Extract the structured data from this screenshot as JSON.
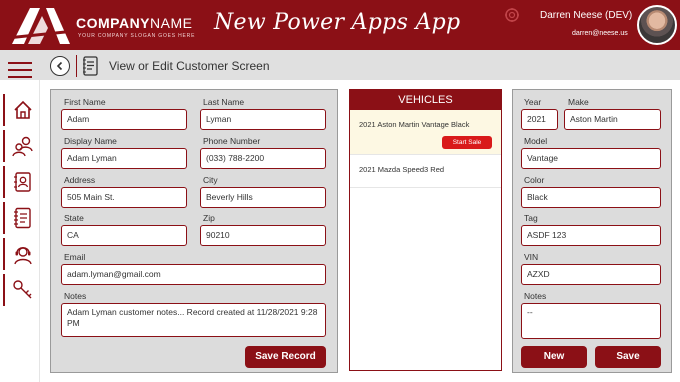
{
  "header": {
    "company_bold": "COMPANY",
    "company_light": "NAME",
    "slogan": "YOUR COMPANY SLOGAN GOES HERE",
    "app_title": "New Power Apps App",
    "user_name": "Darren Neese (DEV)",
    "user_email": "darren@neese.us"
  },
  "subheader": {
    "screen_title": "View or Edit Customer Screen"
  },
  "sidebar": {
    "items": [
      "home-icon",
      "people-icon",
      "contact-card-icon",
      "notebook-icon",
      "support-agent-icon",
      "keys-icon"
    ]
  },
  "customer": {
    "first_name_label": "First Name",
    "first_name": "Adam",
    "last_name_label": "Last Name",
    "last_name": "Lyman",
    "display_name_label": "Display Name",
    "display_name": "Adam Lyman",
    "phone_label": "Phone Number",
    "phone": "(033) 788-2200",
    "address_label": "Address",
    "address": "505 Main St.",
    "city_label": "City",
    "city": "Beverly Hills",
    "state_label": "State",
    "state": "CA",
    "zip_label": "Zip",
    "zip": "90210",
    "email_label": "Email",
    "email": "adam.lyman@gmail.com",
    "notes_label": "Notes",
    "notes": "Adam Lyman customer notes... Record created at 11/28/2021 9:28 PM",
    "save_label": "Save Record"
  },
  "vehicles": {
    "title": "VEHICLES",
    "items": [
      {
        "name": "2021 Aston Martin Vantage Black",
        "action": "Start Sale"
      },
      {
        "name": "2021 Mazda Speed3 Red"
      }
    ]
  },
  "vehicle_detail": {
    "year_label": "Year",
    "year": "2021",
    "make_label": "Make",
    "make": "Aston Martin",
    "model_label": "Model",
    "model": "Vantage",
    "color_label": "Color",
    "color": "Black",
    "tag_label": "Tag",
    "tag": "ASDF 123",
    "vin_label": "VIN",
    "vin": "AZXD",
    "notes_label": "Notes",
    "notes": "--",
    "new_label": "New",
    "save_label": "Save"
  },
  "colors": {
    "brand": "#8b1016",
    "accent": "#d91a1a"
  }
}
